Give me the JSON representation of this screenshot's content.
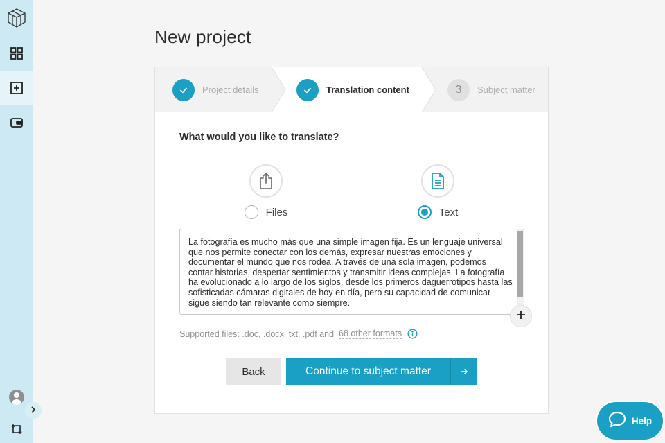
{
  "page": {
    "title": "New project"
  },
  "sidebar": {
    "items": [
      {
        "icon": "logo-cube-icon"
      },
      {
        "icon": "dashboard-grid-icon"
      },
      {
        "icon": "new-project-plus-icon",
        "active": true
      },
      {
        "icon": "wallet-icon"
      }
    ],
    "bottom": {
      "avatar_icon": "user-avatar-icon",
      "expand_icon": "chevron-right-icon",
      "switch_icon": "switch-account-icon"
    }
  },
  "stepper": {
    "steps": [
      {
        "label": "Project details",
        "state": "done"
      },
      {
        "label": "Translation content",
        "state": "current"
      },
      {
        "number": "3",
        "label": "Subject matter",
        "state": "pending"
      }
    ]
  },
  "content": {
    "question": "What would you like to translate?",
    "options": [
      {
        "label": "Files",
        "icon": "upload-icon",
        "selected": false
      },
      {
        "label": "Text",
        "icon": "document-icon",
        "selected": true
      }
    ],
    "text_value": "La fotografía es mucho más que una simple imagen fija. Es un lenguaje universal que nos permite conectar con los demás, expresar nuestras emociones y documentar el mundo que nos rodea. A través de una sola imagen, podemos contar historias, despertar sentimientos y transmitir ideas complejas. La fotografía ha evolucionado a lo largo de los siglos, desde los primeros daguerrotipos hasta las sofisticadas cámaras digitales de hoy en día, pero su capacidad de comunicar sigue siendo tan relevante como siempre.",
    "supported_prefix": "Supported files: .doc, .docx, txt, .pdf and",
    "supported_link": "68 other formats"
  },
  "actions": {
    "back_label": "Back",
    "continue_label": "Continue to subject matter"
  },
  "help": {
    "label": "Help"
  },
  "colors": {
    "accent": "#1aa0c4",
    "sidebar": "#cde9f3"
  }
}
